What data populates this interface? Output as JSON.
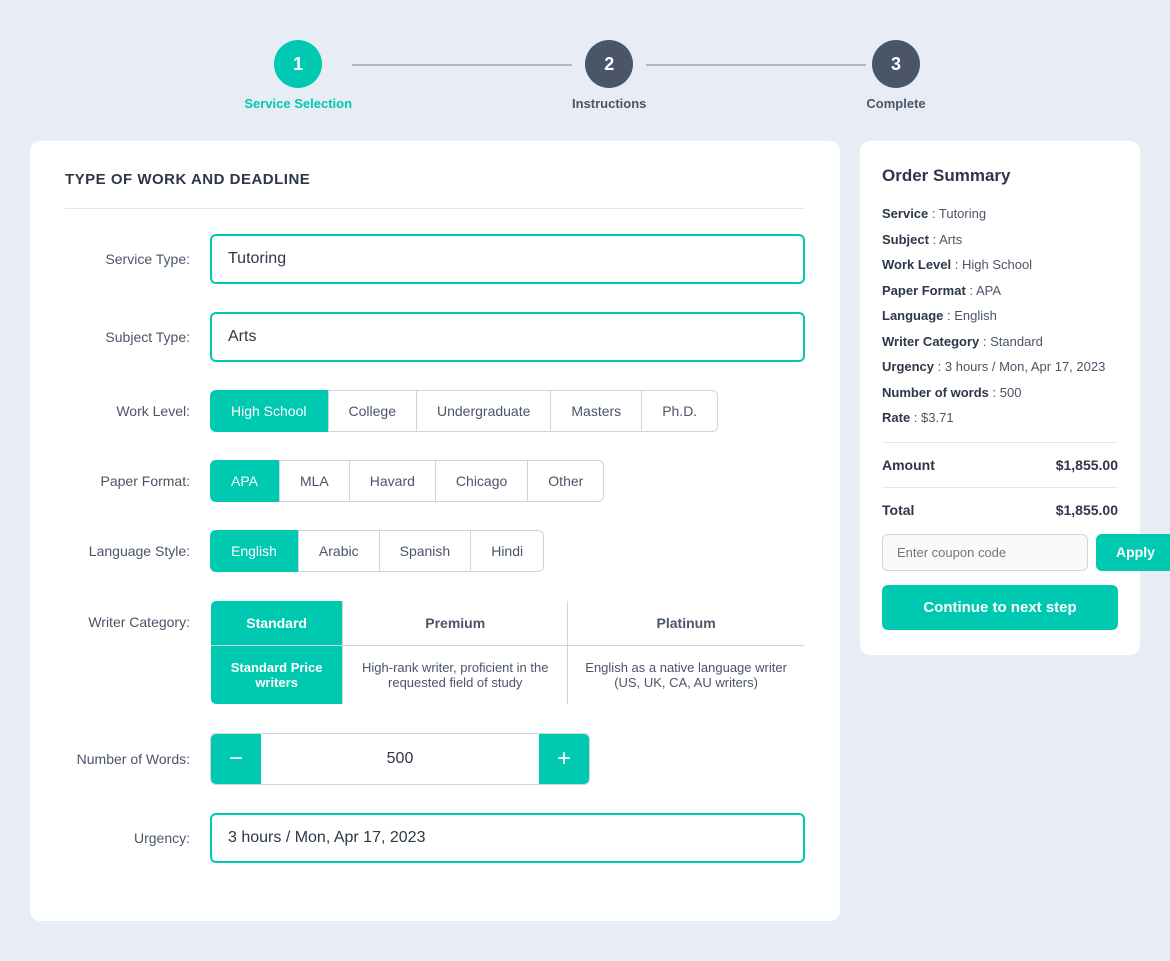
{
  "stepper": {
    "steps": [
      {
        "number": "1",
        "label": "Service Selection",
        "state": "active"
      },
      {
        "number": "2",
        "label": "Instructions",
        "state": "inactive"
      },
      {
        "number": "3",
        "label": "Complete",
        "state": "inactive"
      }
    ]
  },
  "form": {
    "section_title": "TYPE OF WORK AND DEADLINE",
    "service_type": {
      "label": "Service Type:",
      "value": "Tutoring"
    },
    "subject_type": {
      "label": "Subject Type:",
      "value": "Arts"
    },
    "work_level": {
      "label": "Work Level:",
      "options": [
        {
          "id": "high-school",
          "label": "High School",
          "selected": true
        },
        {
          "id": "college",
          "label": "College",
          "selected": false
        },
        {
          "id": "undergraduate",
          "label": "Undergraduate",
          "selected": false
        },
        {
          "id": "masters",
          "label": "Masters",
          "selected": false
        },
        {
          "id": "phd",
          "label": "Ph.D.",
          "selected": false
        }
      ]
    },
    "paper_format": {
      "label": "Paper Format:",
      "options": [
        {
          "id": "apa",
          "label": "APA",
          "selected": true
        },
        {
          "id": "mla",
          "label": "MLA",
          "selected": false
        },
        {
          "id": "harvard",
          "label": "Havard",
          "selected": false
        },
        {
          "id": "chicago",
          "label": "Chicago",
          "selected": false
        },
        {
          "id": "other",
          "label": "Other",
          "selected": false
        }
      ]
    },
    "language_style": {
      "label": "Language Style:",
      "options": [
        {
          "id": "english",
          "label": "English",
          "selected": true
        },
        {
          "id": "arabic",
          "label": "Arabic",
          "selected": false
        },
        {
          "id": "spanish",
          "label": "Spanish",
          "selected": false
        },
        {
          "id": "hindi",
          "label": "Hindi",
          "selected": false
        }
      ]
    },
    "writer_category": {
      "label": "Writer Category:",
      "options": [
        {
          "id": "standard",
          "title": "Standard",
          "description": "Standard Price writers",
          "selected": true
        },
        {
          "id": "premium",
          "title": "Premium",
          "description": "High-rank writer, proficient in the requested field of study",
          "selected": false
        },
        {
          "id": "platinum",
          "title": "Platinum",
          "description": "English as a native language writer (US, UK, CA, AU writers)",
          "selected": false
        }
      ]
    },
    "number_of_words": {
      "label": "Number of Words:",
      "value": 500,
      "minus_label": "-",
      "plus_label": "+"
    },
    "urgency": {
      "label": "Urgency:",
      "value": "3 hours / Mon, Apr 17, 2023"
    }
  },
  "order_summary": {
    "title": "Order Summary",
    "items": [
      {
        "key": "Service",
        "value": "Tutoring"
      },
      {
        "key": "Subject",
        "value": "Arts"
      },
      {
        "key": "Work Level",
        "value": "High School"
      },
      {
        "key": "Paper Format",
        "value": "APA"
      },
      {
        "key": "Language",
        "value": "English"
      },
      {
        "key": "Writer Category",
        "value": "Standard"
      },
      {
        "key": "Urgency",
        "value": "3 hours / Mon, Apr 17, 2023"
      },
      {
        "key": "Number of words",
        "value": "500"
      },
      {
        "key": "Rate",
        "value": "$3.71"
      }
    ],
    "amount_label": "Amount",
    "amount_value": "$1,855.00",
    "total_label": "Total",
    "total_value": "$1,855.00",
    "coupon_placeholder": "Enter coupon code",
    "apply_label": "Apply",
    "continue_label": "Continue to next step"
  }
}
